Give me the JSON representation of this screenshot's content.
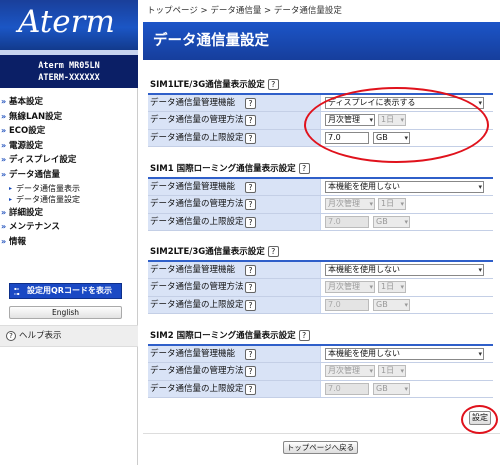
{
  "sidebar": {
    "logo": "Aterm",
    "model_line1": "Aterm   MR05LN",
    "model_line2": "ATERM-XXXXXX",
    "nav": [
      {
        "label": "基本設定",
        "type": "item"
      },
      {
        "label": "無線LAN設定",
        "type": "item"
      },
      {
        "label": "ECO設定",
        "type": "item"
      },
      {
        "label": "電源設定",
        "type": "item"
      },
      {
        "label": "ディスプレイ設定",
        "type": "item"
      },
      {
        "label": "データ通信量",
        "type": "item"
      },
      {
        "label": "データ通信量表示",
        "type": "sub"
      },
      {
        "label": "データ通信量設定",
        "type": "sub"
      },
      {
        "label": "詳細設定",
        "type": "item"
      },
      {
        "label": "メンテナンス",
        "type": "item"
      },
      {
        "label": "情報",
        "type": "item"
      }
    ],
    "qr_button": "設定用QRコードを表示",
    "english_button": "English",
    "help": "ヘルプ表示"
  },
  "main": {
    "breadcrumb": "トップページ > データ通信量 > データ通信量設定",
    "title": "データ通信量設定",
    "sections": [
      {
        "title": "SIM1LTE/3G通信量表示設定",
        "rows": [
          {
            "label": "データ通信量管理機能",
            "value": "ディスプレイに表示する"
          },
          {
            "label": "データ通信量の管理方法",
            "method": "月次管理",
            "day": "1日"
          },
          {
            "label": "データ通信量の上限設定",
            "limit": "7.0",
            "unit": "GB"
          }
        ]
      },
      {
        "title": "SIM1 国際ローミング通信量表示設定",
        "rows": [
          {
            "label": "データ通信量管理機能",
            "value": "本機能を使用しない"
          },
          {
            "label": "データ通信量の管理方法",
            "method": "月次管理",
            "day": "1日"
          },
          {
            "label": "データ通信量の上限設定",
            "limit": "7.0",
            "unit": "GB"
          }
        ]
      },
      {
        "title": "SIM2LTE/3G通信量表示設定",
        "rows": [
          {
            "label": "データ通信量管理機能",
            "value": "本機能を使用しない"
          },
          {
            "label": "データ通信量の管理方法",
            "method": "月次管理",
            "day": "1日"
          },
          {
            "label": "データ通信量の上限設定",
            "limit": "7.0",
            "unit": "GB"
          }
        ]
      },
      {
        "title": "SIM2 国際ローミング通信量表示設定",
        "rows": [
          {
            "label": "データ通信量管理機能",
            "value": "本機能を使用しない"
          },
          {
            "label": "データ通信量の管理方法",
            "method": "月次管理",
            "day": "1日"
          },
          {
            "label": "データ通信量の上限設定",
            "limit": "7.0",
            "unit": "GB"
          }
        ]
      }
    ],
    "submit_button": "設定",
    "top_button": "トップページへ戻る"
  },
  "icons": {
    "help": "?",
    "arrow": "»",
    "dropdown": "▾",
    "qr": "QR-icon"
  },
  "colors": {
    "accent": "#1b4dbb",
    "highlight": "#e0121c",
    "label_bg": "#d9e3f6"
  }
}
